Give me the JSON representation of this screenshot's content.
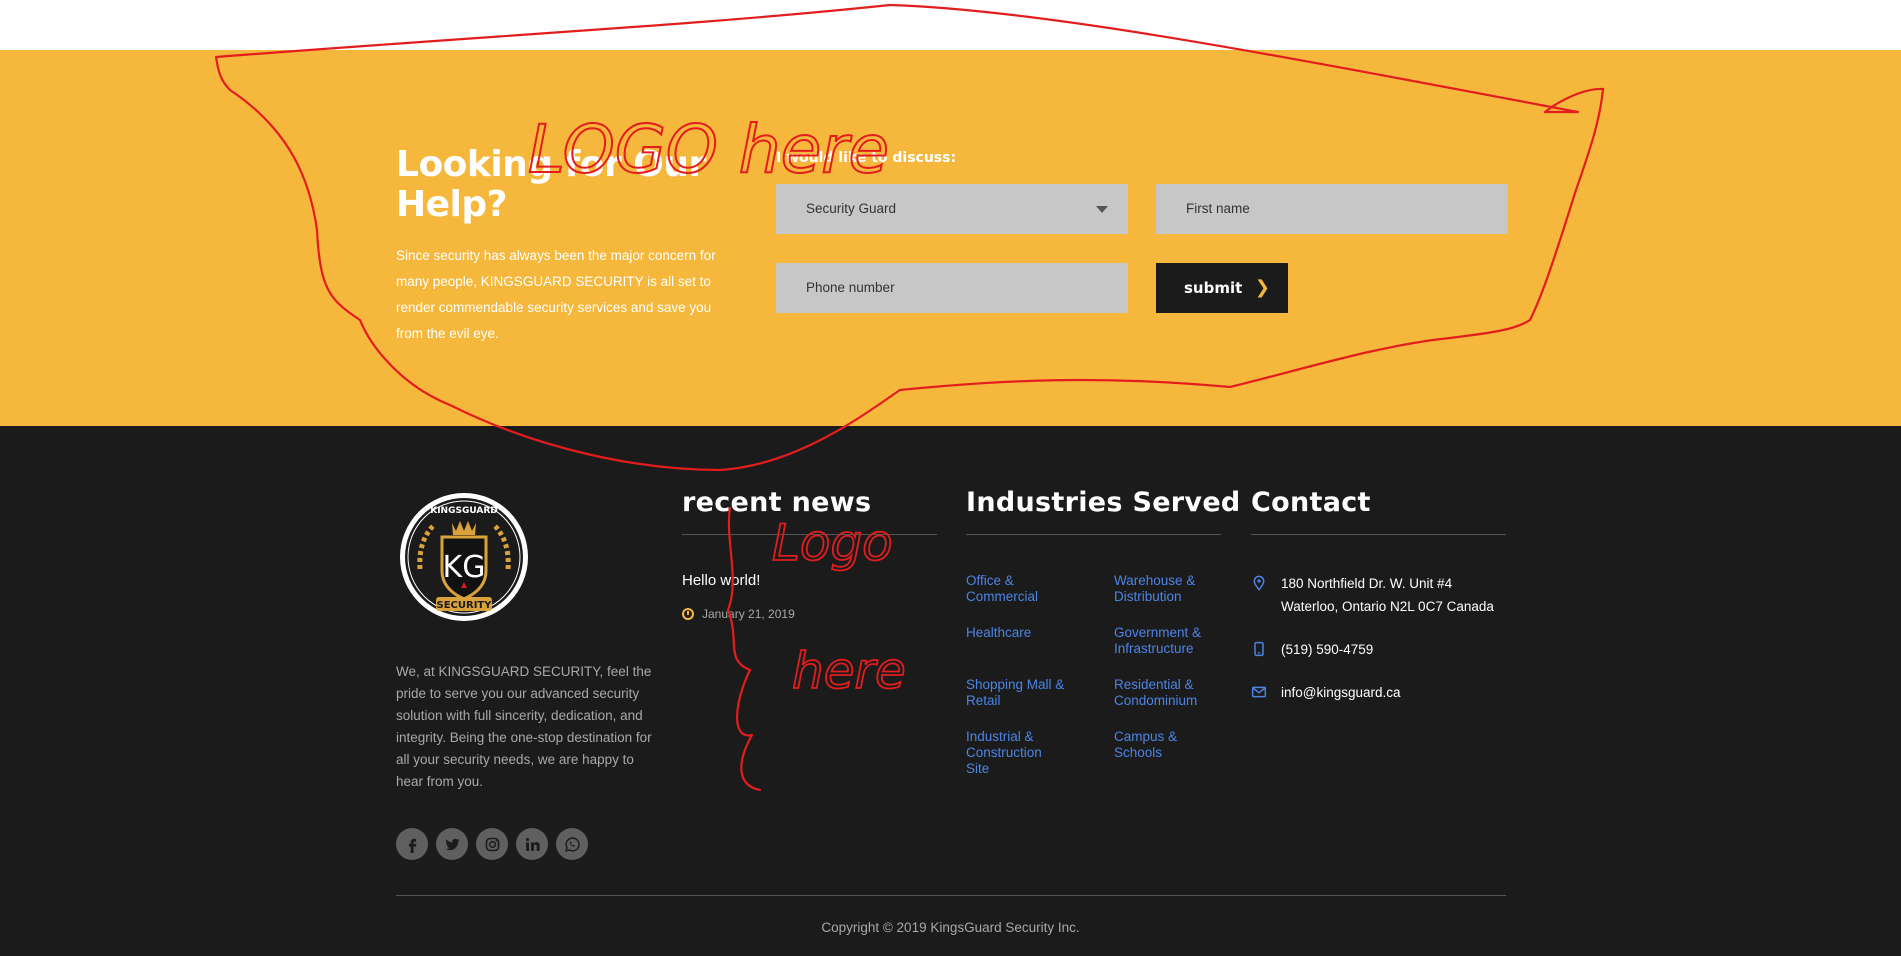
{
  "cta": {
    "title": "Looking for Our Help?",
    "text": "Since security has always been the major concern for many people, KINGSGUARD SECURITY is all set to render commendable security services and save you from the evil eye.",
    "form_label": "I would like to discuss:",
    "select_value": "Security Guard",
    "first_name_placeholder": "First name",
    "phone_placeholder": "Phone number",
    "submit_label": "submit"
  },
  "footer": {
    "logo": {
      "name": "KINGSGUARD",
      "initials": "KG",
      "word": "SECURITY"
    },
    "about": "We, at KINGSGUARD SECURITY, feel the pride to serve you our advanced security solution with full sincerity, dedication, and integrity. Being the one-stop destination for all your security needs, we are happy to hear from you.",
    "socials": [
      "facebook-icon",
      "twitter-icon",
      "instagram-icon",
      "linkedin-icon",
      "whatsapp-icon"
    ],
    "news": {
      "title": "recent news",
      "items": [
        {
          "title": "Hello world!",
          "date": "January 21, 2019"
        }
      ]
    },
    "industries": {
      "title": "Industries Served",
      "items": [
        {
          "label": "Office & Commercial"
        },
        {
          "label": "Warehouse & Distribution"
        },
        {
          "label": "Healthcare"
        },
        {
          "label": "Government & Infrastructure"
        },
        {
          "label": "Shopping Mall & Retail"
        },
        {
          "label": "Residential & Condominium"
        },
        {
          "label": "Industrial & Construction Site"
        },
        {
          "label": "Campus & Schools"
        }
      ]
    },
    "contact": {
      "title": "Contact",
      "address_line1": "180 Northfield Dr. W. Unit #4",
      "address_line2": "Waterloo, Ontario N2L 0C7 Canada",
      "phone": "(519) 590-4759",
      "email": "info@kingsguard.ca"
    },
    "copyright": "Copyright © 2019 KingsGuard Security Inc."
  },
  "annotations": {
    "top_text": "LOGO here",
    "side_text_1": "Logo",
    "side_text_2": "here"
  },
  "colors": {
    "cta_background": "#f5b83d",
    "footer_background": "#1b1b1b",
    "link": "#4c84e6",
    "annotation": "#e31d1d"
  }
}
